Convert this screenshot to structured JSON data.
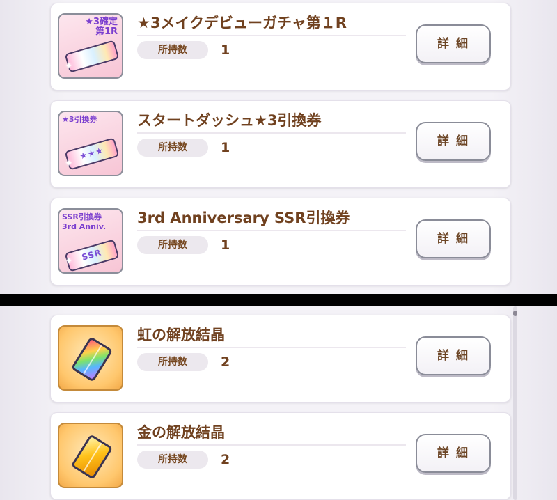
{
  "items": [
    {
      "name": "★3メイクデビューガチャ第１R",
      "owned_label": "所持数",
      "count": "1",
      "detail_label": "詳細",
      "icon": {
        "type": "ticket",
        "label_line1": "★3確定",
        "label_line2": "第1R",
        "ticket_text": ""
      }
    },
    {
      "name": "スタートダッシュ★3引換券",
      "owned_label": "所持数",
      "count": "1",
      "detail_label": "詳細",
      "icon": {
        "type": "ticket",
        "label_line1": "★3引換券",
        "label_line2": "",
        "ticket_text": "★★★"
      }
    },
    {
      "name": "3rd Anniversary SSR引換券",
      "owned_label": "所持数",
      "count": "1",
      "detail_label": "詳細",
      "icon": {
        "type": "ticket",
        "label_line1": "SSR引換券",
        "label_line2": "3rd Anniv.",
        "ticket_text": "SSR"
      }
    },
    {
      "name": "虹の解放結晶",
      "owned_label": "所持数",
      "count": "2",
      "detail_label": "詳細",
      "icon": {
        "type": "gem",
        "color": "rainbow"
      }
    },
    {
      "name": "金の解放結晶",
      "owned_label": "所持数",
      "count": "2",
      "detail_label": "詳細",
      "icon": {
        "type": "gem",
        "color": "gold"
      }
    }
  ]
}
